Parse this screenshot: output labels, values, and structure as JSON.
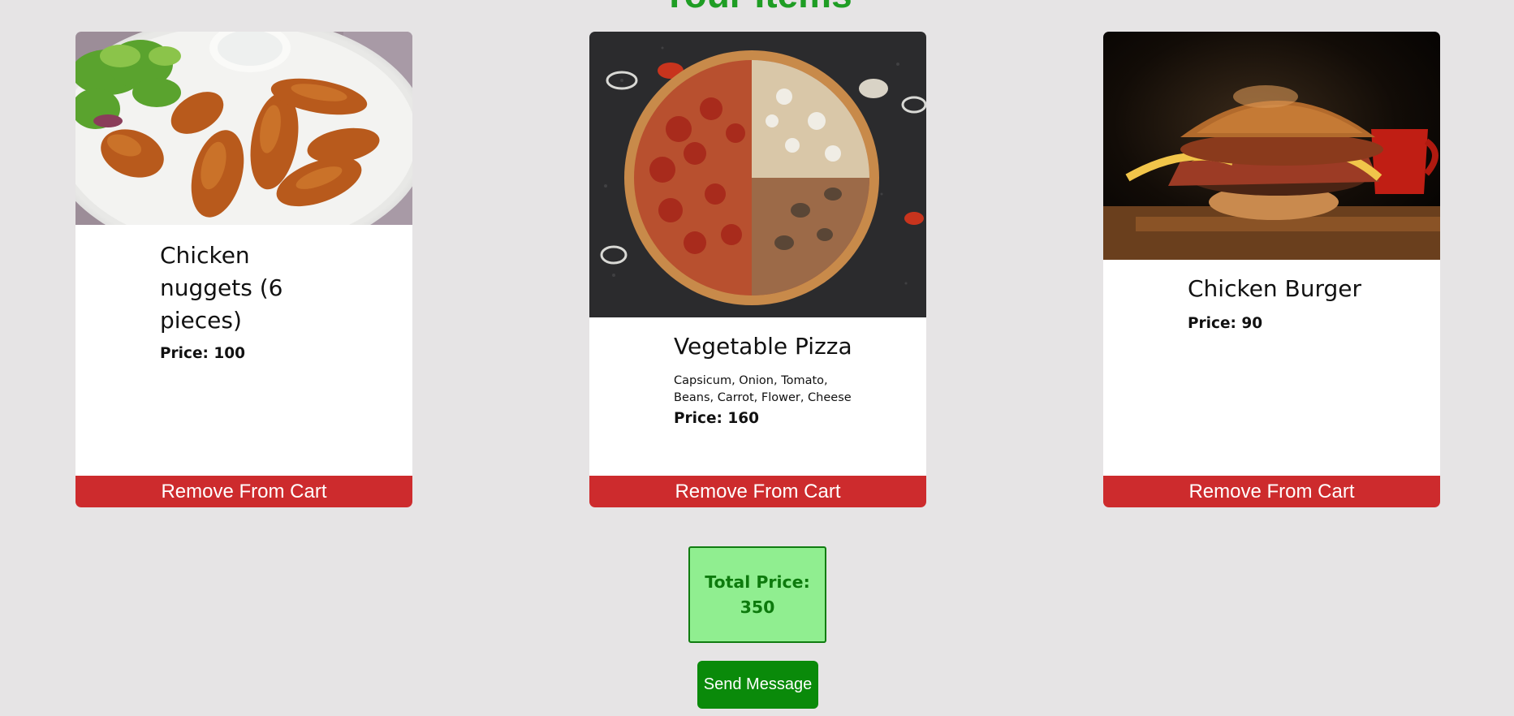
{
  "page": {
    "title": "Your Items"
  },
  "cart": {
    "items": [
      {
        "name": "Chicken nuggets (6 pieces)",
        "description": "",
        "price_label": "Price: 100",
        "price": 100,
        "image_icon": "chicken-nuggets-image",
        "remove_label": "Remove From Cart"
      },
      {
        "name": "Vegetable Pizza",
        "description": "Capsicum, Onion, Tomato, Beans, Carrot, Flower, Cheese",
        "price_label": "Price: 160",
        "price": 160,
        "image_icon": "vegetable-pizza-image",
        "remove_label": "Remove From Cart"
      },
      {
        "name": "Chicken Burger",
        "description": "",
        "price_label": "Price: 90",
        "price": 90,
        "image_icon": "chicken-burger-image",
        "remove_label": "Remove From Cart"
      }
    ],
    "total_label": "Total Price: 350",
    "total": 350,
    "send_label": "Send Message"
  },
  "colors": {
    "background": "#e6e4e5",
    "remove_button": "#cd2b2d",
    "total_box_fill": "#90ee90",
    "total_box_border": "#107c10",
    "send_button": "#0a8a0a",
    "title": "#1f9d24"
  }
}
